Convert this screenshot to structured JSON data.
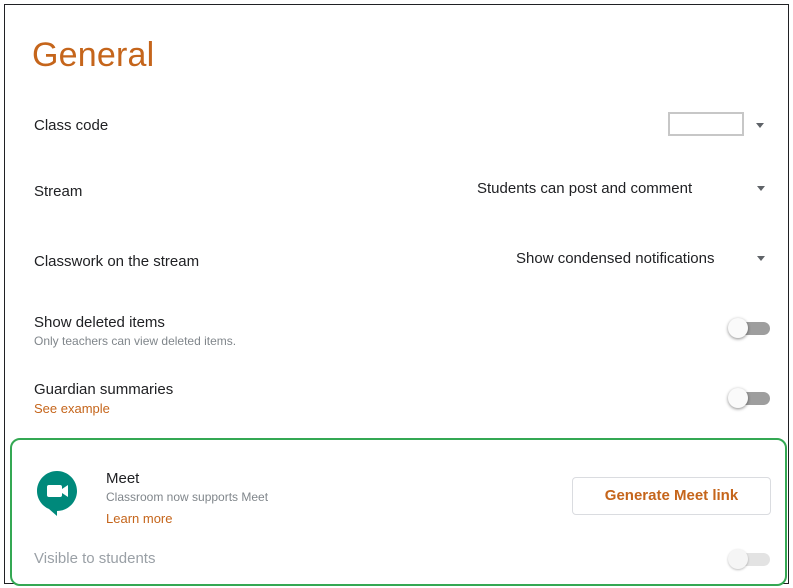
{
  "section": {
    "title": "General"
  },
  "settings": {
    "class_code": {
      "label": "Class code"
    },
    "stream": {
      "label": "Stream",
      "value": "Students can post and comment"
    },
    "classwork": {
      "label": "Classwork on the stream",
      "value": "Show condensed notifications"
    },
    "deleted": {
      "label": "Show deleted items",
      "description": "Only teachers can view deleted items.",
      "enabled": false
    },
    "guardian": {
      "label": "Guardian summaries",
      "link": "See example",
      "enabled": false
    }
  },
  "meet": {
    "title": "Meet",
    "description": "Classroom now supports Meet",
    "learn_more": "Learn more",
    "button_label": "Generate Meet link",
    "visible_label": "Visible to students",
    "visible_enabled": false,
    "icon": "google-meet-logo"
  },
  "colors": {
    "accent": "#c5651b",
    "highlight_border": "#34a853",
    "meet_logo": "#00897b"
  }
}
